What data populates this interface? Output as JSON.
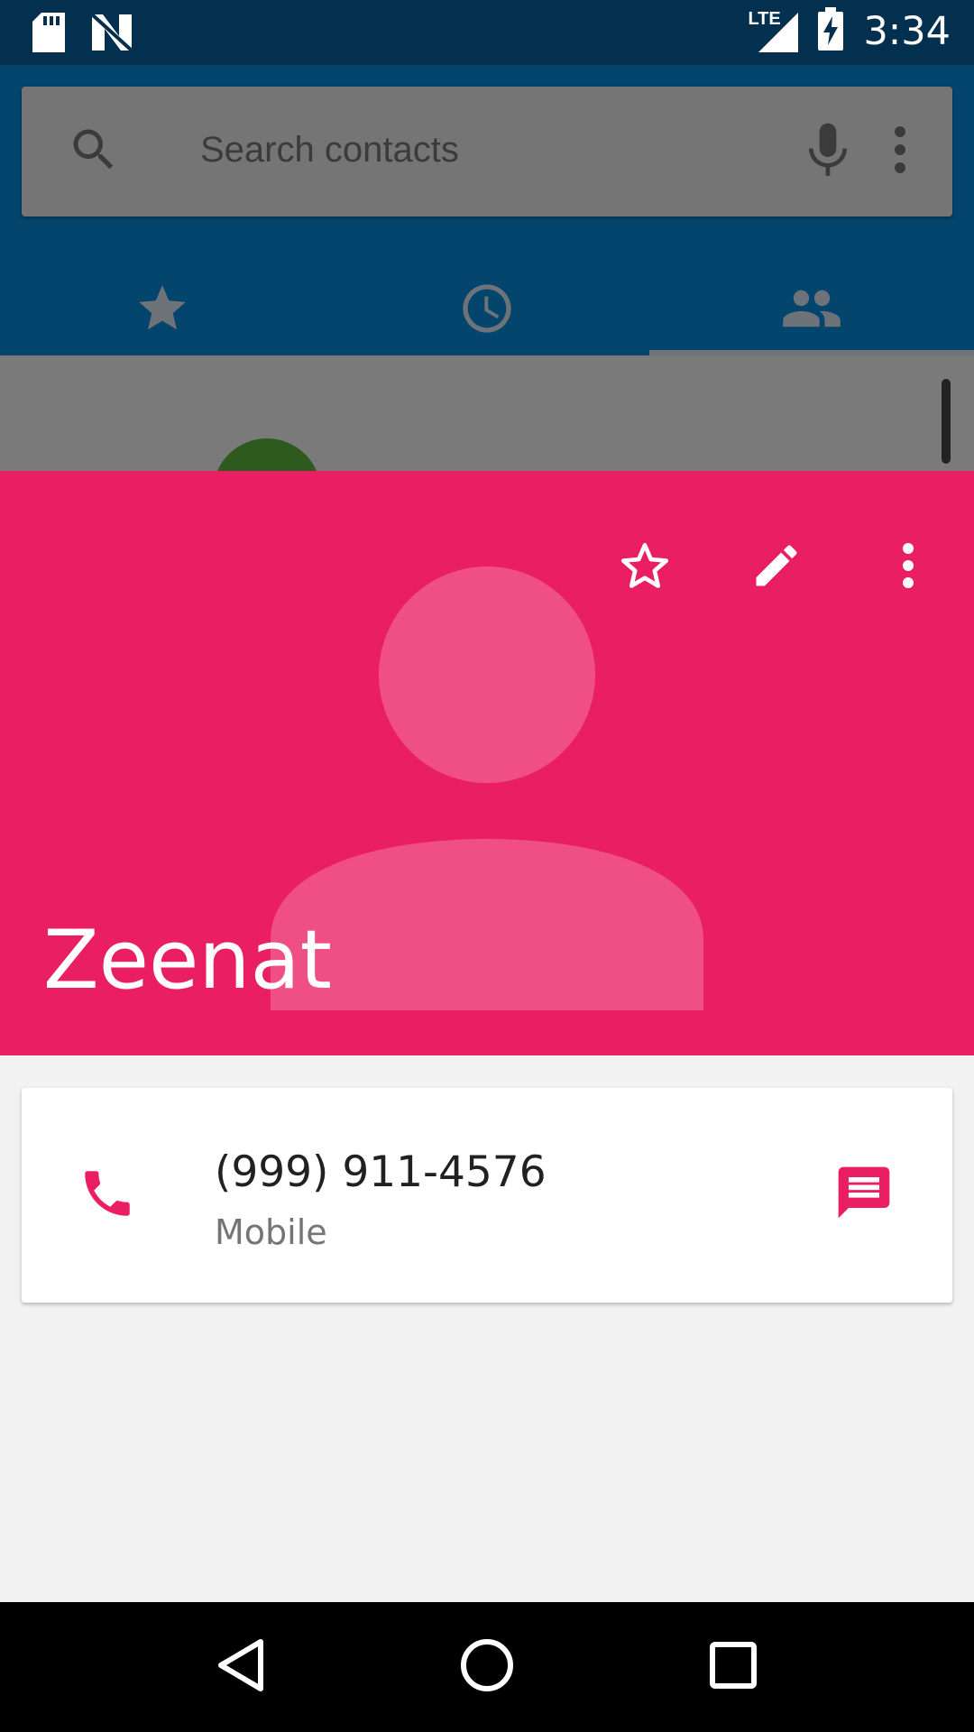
{
  "status_bar": {
    "time": "3:34",
    "network": "LTE",
    "icons": [
      "sd-card-icon",
      "n-notification-icon",
      "lte-signal-icon",
      "battery-charging-icon"
    ]
  },
  "search": {
    "placeholder": "Search contacts",
    "icons": [
      "search-icon",
      "mic-icon",
      "more-vert-icon"
    ]
  },
  "tabs": [
    {
      "icon": "star-icon",
      "label": "Favorites",
      "selected": false
    },
    {
      "icon": "clock-icon",
      "label": "Recents",
      "selected": false
    },
    {
      "icon": "people-icon",
      "label": "Contacts",
      "selected": true
    }
  ],
  "contact": {
    "name": "Zeenat",
    "header_color": "#e91e63",
    "actions": [
      "star-outline-icon",
      "edit-icon",
      "more-vert-icon"
    ],
    "phones": [
      {
        "number": "(999) 911-4576",
        "type": "Mobile"
      }
    ]
  },
  "colors": {
    "accent": "#e91e63",
    "app_bar": "#04456e",
    "status_bar": "#03304f"
  },
  "nav_bar": [
    "back-icon",
    "home-icon",
    "recents-icon"
  ]
}
